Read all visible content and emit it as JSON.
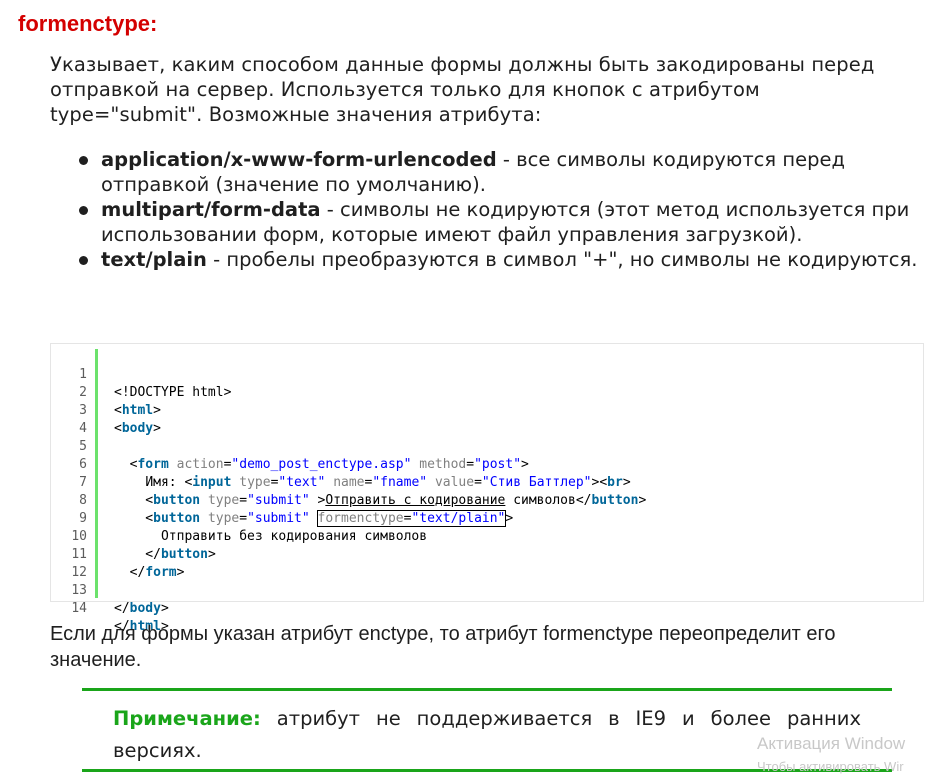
{
  "heading": "formenctype:",
  "intro": "Указывает, каким способом данные формы должны быть закодированы перед отправкой на сервер. Используется только для кнопок с атрибутом type=\"submit\". Возможные значения атрибута:",
  "values": [
    {
      "term": "application/x-www-form-urlencoded",
      "desc": " - все символы кодируются перед отправкой (значение по умолчанию)."
    },
    {
      "term": "multipart/form-data",
      "desc": " - символы не кодируются (этот метод используется при использовании форм, которые имеют файл управления загрузкой)."
    },
    {
      "term": "text/plain",
      "desc": " - пробелы преобразуются в символ \"+\", но символы не кодируются."
    }
  ],
  "code": {
    "line_numbers": [
      "1",
      "2",
      "3",
      "4",
      "5",
      "6",
      "7",
      "8",
      "9",
      "10",
      "11",
      "12",
      "13",
      "14"
    ],
    "l1": "<!DOCTYPE html>",
    "tag_html": "html",
    "tag_body": "body",
    "tag_form": "form",
    "tag_input": "input",
    "tag_button": "button",
    "tag_br": "br",
    "attr_action": "action",
    "attr_method": "method",
    "attr_type": "type",
    "attr_name": "name",
    "attr_value": "value",
    "attr_formenctype": "formenctype",
    "val_action": "\"demo_post_enctype.asp\"",
    "val_method": "\"post\"",
    "val_text": "\"text\"",
    "val_fname": "\"fname\"",
    "val_name": "\"Стив Баттлер\"",
    "val_submit": "\"submit\"",
    "val_plain": "\"text/plain\"",
    "label_name": "Имя:",
    "btn1_text_a": "Отправить с кодирование",
    "btn1_text_b": " символов",
    "btn2_text": "Отправить без кодирования символов"
  },
  "outro": "Если для формы указан атрибут enctype, то атрибут formenctype переопределит его значение.",
  "note": {
    "label": "Примечание:",
    "text": " атрибут не поддерживается в IE9 и более ранних версиях."
  },
  "watermark": {
    "line1": "Активация Window",
    "line2": "Чтобы активировать Wir"
  },
  "colors": {
    "heading": "#d40000",
    "accent_green": "#1aa51a",
    "gutter": "#6ce26c",
    "keyword": "#006699",
    "attribute": "#808080",
    "string": "#0000ff"
  }
}
